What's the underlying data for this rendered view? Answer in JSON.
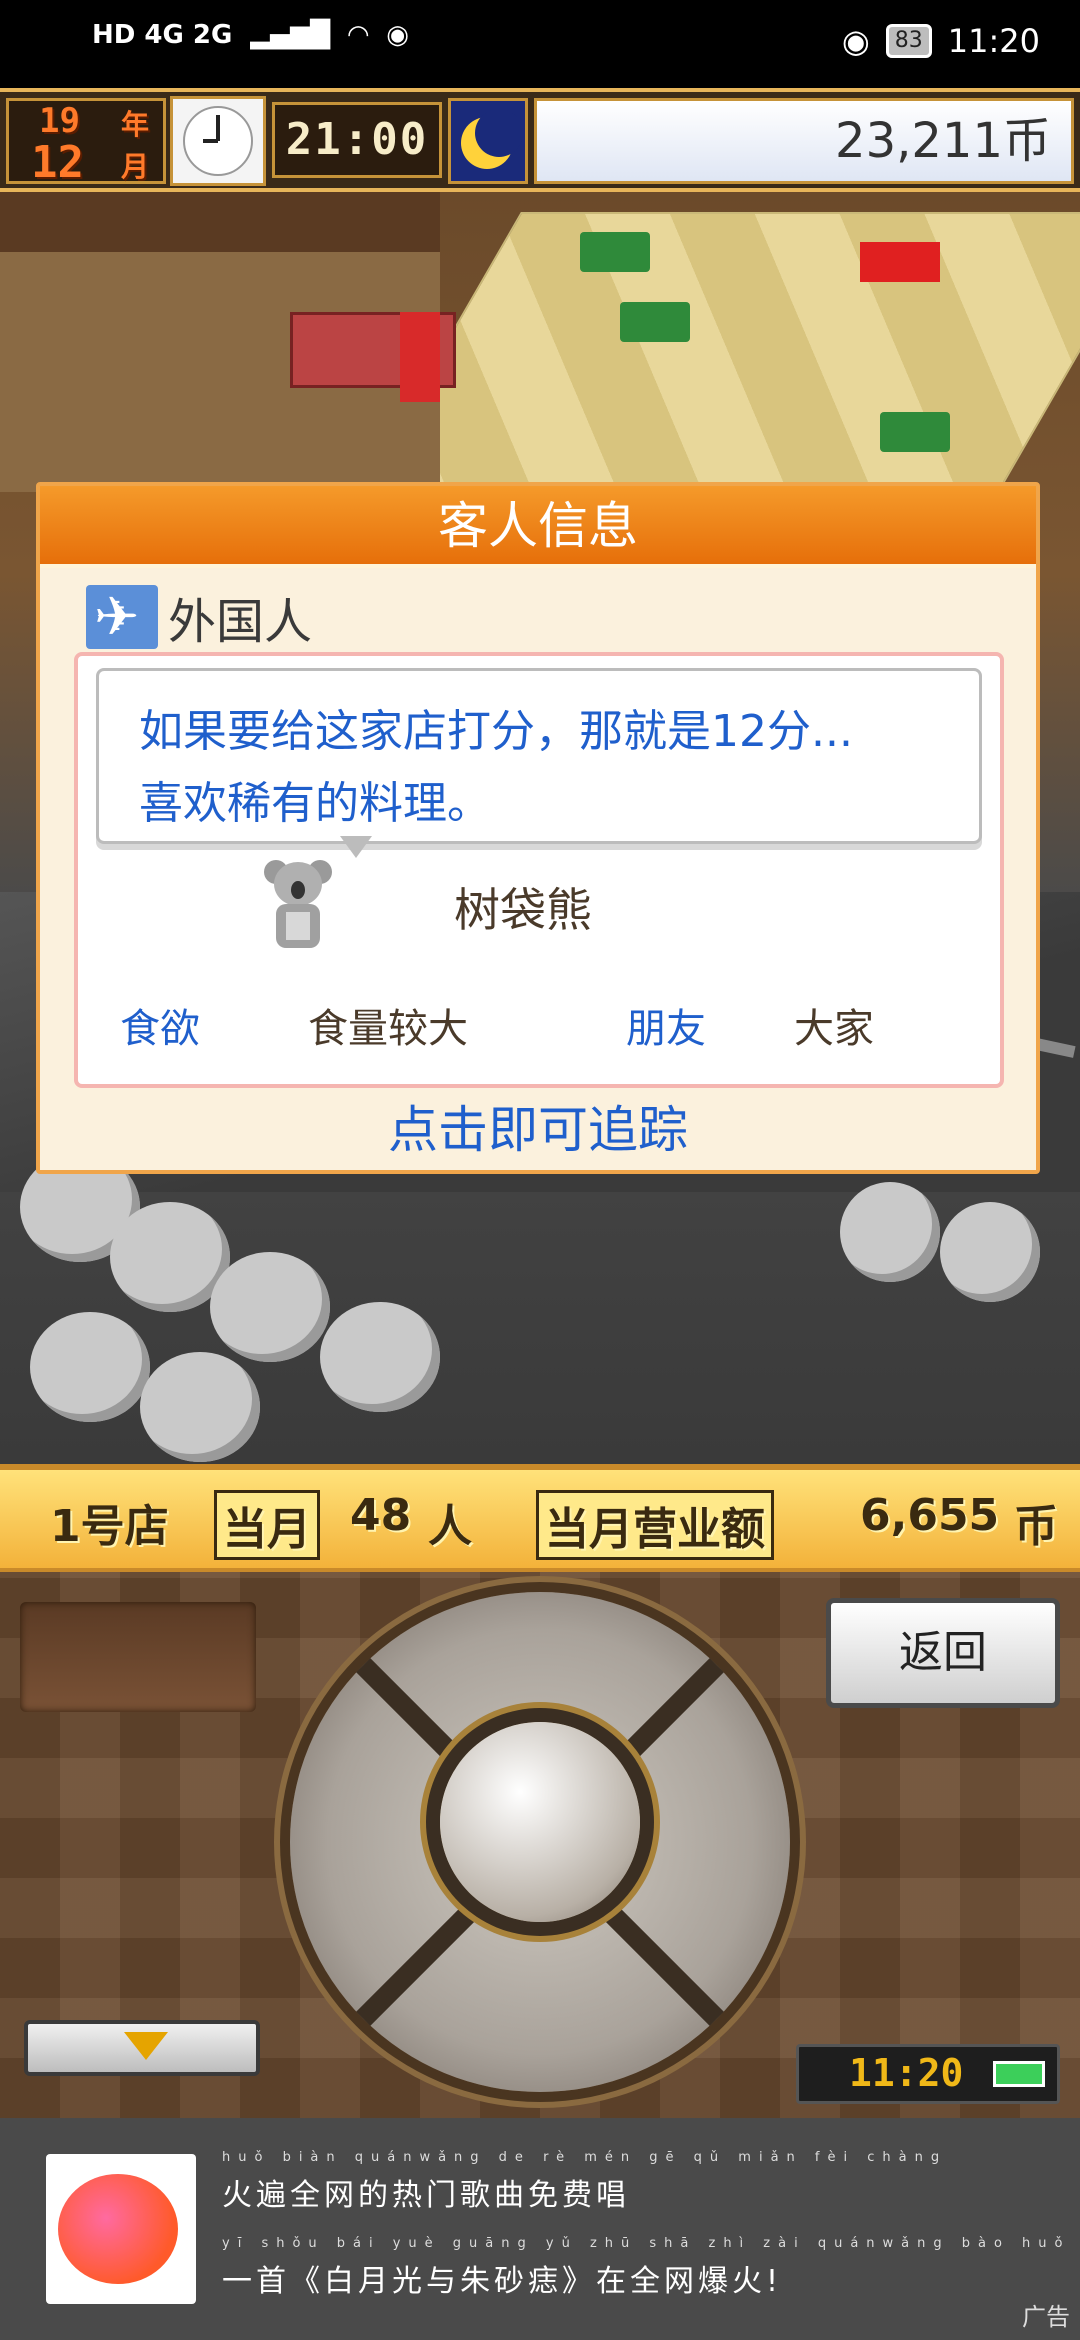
{
  "status_bar": {
    "network_left": "HD 4G 2G",
    "battery": "83",
    "time": "11:20",
    "icons": [
      "signal-icon",
      "wifi-icon",
      "eye-icon",
      "battery-icon"
    ]
  },
  "hud": {
    "year_value": "19",
    "year_label": "年",
    "month_value": "12",
    "month_label": "月",
    "game_time": "21:00",
    "money": "23,211币"
  },
  "dialog": {
    "title": "客人信息",
    "nationality": "外国人",
    "speech_line1": "如果要给这家店打分，那就是12分...",
    "speech_line2": "喜欢稀有的料理。",
    "animal_name": "树袋熊",
    "stat1_label": "食欲",
    "stat1_value": "食量较大",
    "stat2_label": "朋友",
    "stat2_value": "大家",
    "track_hint": "点击即可追踪"
  },
  "stats_strip": {
    "store": "1号店",
    "month_label": "当月",
    "customers": "48",
    "customers_unit": "人",
    "sales_label": "当月营业额",
    "sales_value": "6,655",
    "sales_unit": "币"
  },
  "controller": {
    "back_label": "返回",
    "clock": "11:20"
  },
  "ad": {
    "line1_pinyin": "huǒ biàn quánwǎng de rè mén gē qǔ miǎn fèi chàng",
    "line1": "火遍全网的热门歌曲免费唱",
    "line2_pinyin": "yī shǒu bái yuè guāng yǔ zhū shā zhì zài quánwǎng bào huǒ",
    "line2": "一首《白月光与朱砂痣》在全网爆火!",
    "tag": "广告"
  }
}
